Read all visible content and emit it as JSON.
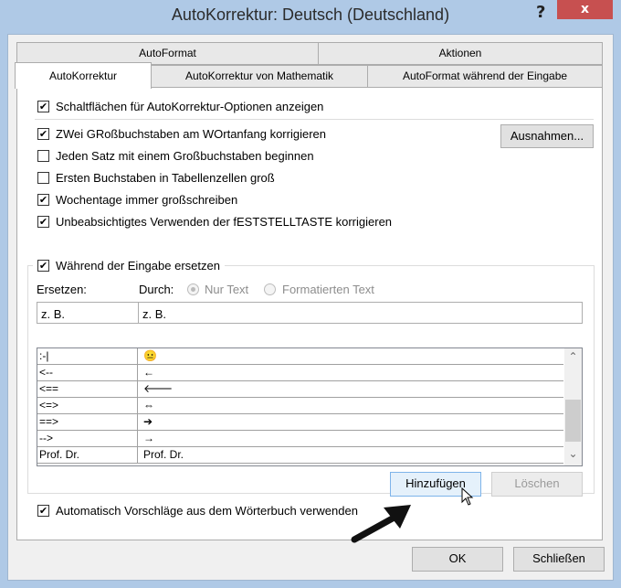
{
  "window": {
    "title": "AutoKorrektur: Deutsch (Deutschland)",
    "help": "?",
    "close": "x"
  },
  "tabs": {
    "row1": [
      "AutoFormat",
      "Aktionen"
    ],
    "row2": [
      "AutoKorrektur",
      "AutoKorrektur von Mathematik",
      "AutoFormat während der Eingabe"
    ],
    "selected": "AutoKorrektur"
  },
  "options": [
    {
      "label": "Schaltflächen für AutoKorrektur-Optionen anzeigen",
      "checked": true
    },
    {
      "label": "ZWei GRoßbuchstaben am WOrtanfang korrigieren",
      "checked": true
    },
    {
      "label": "Jeden Satz mit einem Großbuchstaben beginnen",
      "checked": false
    },
    {
      "label": "Ersten Buchstaben in Tabellenzellen groß",
      "checked": false
    },
    {
      "label": "Wochentage immer großschreiben",
      "checked": true
    },
    {
      "label": "Unbeabsichtigtes Verwenden der fESTSTELLTASTE korrigieren",
      "checked": true
    }
  ],
  "exceptions_button": "Ausnahmen...",
  "replace_group": {
    "label": "Während der Eingabe ersetzen",
    "checked": true,
    "replace_label": "Ersetzen:",
    "with_label": "Durch:",
    "radio_plain": "Nur Text",
    "radio_formatted": "Formatierten Text",
    "replace_value": "z. B.",
    "with_value": "z. B."
  },
  "check": "✔",
  "list": [
    {
      "from": ":-|",
      "to": "😐"
    },
    {
      "from": "<--",
      "to": "←"
    },
    {
      "from": "<==",
      "to": "🡐"
    },
    {
      "from": "<=>",
      "to": "⇔"
    },
    {
      "from": "==>",
      "to": "➔"
    },
    {
      "from": "-->",
      "to": "→"
    },
    {
      "from": "Prof. Dr.",
      "to": "Prof. Dr."
    }
  ],
  "scroll_up": "⌃",
  "scroll_down": "⌄",
  "add_button": "Hinzufügen",
  "delete_button": "Löschen",
  "suggestions": {
    "label": "Automatisch Vorschläge aus dem Wörterbuch verwenden",
    "checked": true
  },
  "ok_button": "OK",
  "close_button": "Schließen"
}
